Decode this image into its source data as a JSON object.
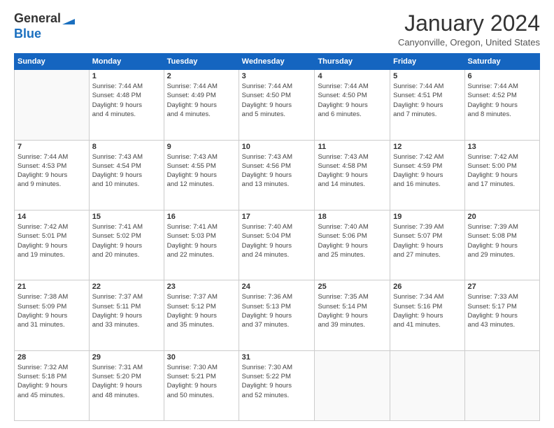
{
  "header": {
    "logo_line1": "General",
    "logo_line2": "Blue",
    "month": "January 2024",
    "location": "Canyonville, Oregon, United States"
  },
  "days_of_week": [
    "Sunday",
    "Monday",
    "Tuesday",
    "Wednesday",
    "Thursday",
    "Friday",
    "Saturday"
  ],
  "weeks": [
    [
      {
        "day": "",
        "info": ""
      },
      {
        "day": "1",
        "info": "Sunrise: 7:44 AM\nSunset: 4:48 PM\nDaylight: 9 hours\nand 4 minutes."
      },
      {
        "day": "2",
        "info": "Sunrise: 7:44 AM\nSunset: 4:49 PM\nDaylight: 9 hours\nand 4 minutes."
      },
      {
        "day": "3",
        "info": "Sunrise: 7:44 AM\nSunset: 4:50 PM\nDaylight: 9 hours\nand 5 minutes."
      },
      {
        "day": "4",
        "info": "Sunrise: 7:44 AM\nSunset: 4:50 PM\nDaylight: 9 hours\nand 6 minutes."
      },
      {
        "day": "5",
        "info": "Sunrise: 7:44 AM\nSunset: 4:51 PM\nDaylight: 9 hours\nand 7 minutes."
      },
      {
        "day": "6",
        "info": "Sunrise: 7:44 AM\nSunset: 4:52 PM\nDaylight: 9 hours\nand 8 minutes."
      }
    ],
    [
      {
        "day": "7",
        "info": "Sunrise: 7:44 AM\nSunset: 4:53 PM\nDaylight: 9 hours\nand 9 minutes."
      },
      {
        "day": "8",
        "info": "Sunrise: 7:43 AM\nSunset: 4:54 PM\nDaylight: 9 hours\nand 10 minutes."
      },
      {
        "day": "9",
        "info": "Sunrise: 7:43 AM\nSunset: 4:55 PM\nDaylight: 9 hours\nand 12 minutes."
      },
      {
        "day": "10",
        "info": "Sunrise: 7:43 AM\nSunset: 4:56 PM\nDaylight: 9 hours\nand 13 minutes."
      },
      {
        "day": "11",
        "info": "Sunrise: 7:43 AM\nSunset: 4:58 PM\nDaylight: 9 hours\nand 14 minutes."
      },
      {
        "day": "12",
        "info": "Sunrise: 7:42 AM\nSunset: 4:59 PM\nDaylight: 9 hours\nand 16 minutes."
      },
      {
        "day": "13",
        "info": "Sunrise: 7:42 AM\nSunset: 5:00 PM\nDaylight: 9 hours\nand 17 minutes."
      }
    ],
    [
      {
        "day": "14",
        "info": "Sunrise: 7:42 AM\nSunset: 5:01 PM\nDaylight: 9 hours\nand 19 minutes."
      },
      {
        "day": "15",
        "info": "Sunrise: 7:41 AM\nSunset: 5:02 PM\nDaylight: 9 hours\nand 20 minutes."
      },
      {
        "day": "16",
        "info": "Sunrise: 7:41 AM\nSunset: 5:03 PM\nDaylight: 9 hours\nand 22 minutes."
      },
      {
        "day": "17",
        "info": "Sunrise: 7:40 AM\nSunset: 5:04 PM\nDaylight: 9 hours\nand 24 minutes."
      },
      {
        "day": "18",
        "info": "Sunrise: 7:40 AM\nSunset: 5:06 PM\nDaylight: 9 hours\nand 25 minutes."
      },
      {
        "day": "19",
        "info": "Sunrise: 7:39 AM\nSunset: 5:07 PM\nDaylight: 9 hours\nand 27 minutes."
      },
      {
        "day": "20",
        "info": "Sunrise: 7:39 AM\nSunset: 5:08 PM\nDaylight: 9 hours\nand 29 minutes."
      }
    ],
    [
      {
        "day": "21",
        "info": "Sunrise: 7:38 AM\nSunset: 5:09 PM\nDaylight: 9 hours\nand 31 minutes."
      },
      {
        "day": "22",
        "info": "Sunrise: 7:37 AM\nSunset: 5:11 PM\nDaylight: 9 hours\nand 33 minutes."
      },
      {
        "day": "23",
        "info": "Sunrise: 7:37 AM\nSunset: 5:12 PM\nDaylight: 9 hours\nand 35 minutes."
      },
      {
        "day": "24",
        "info": "Sunrise: 7:36 AM\nSunset: 5:13 PM\nDaylight: 9 hours\nand 37 minutes."
      },
      {
        "day": "25",
        "info": "Sunrise: 7:35 AM\nSunset: 5:14 PM\nDaylight: 9 hours\nand 39 minutes."
      },
      {
        "day": "26",
        "info": "Sunrise: 7:34 AM\nSunset: 5:16 PM\nDaylight: 9 hours\nand 41 minutes."
      },
      {
        "day": "27",
        "info": "Sunrise: 7:33 AM\nSunset: 5:17 PM\nDaylight: 9 hours\nand 43 minutes."
      }
    ],
    [
      {
        "day": "28",
        "info": "Sunrise: 7:32 AM\nSunset: 5:18 PM\nDaylight: 9 hours\nand 45 minutes."
      },
      {
        "day": "29",
        "info": "Sunrise: 7:31 AM\nSunset: 5:20 PM\nDaylight: 9 hours\nand 48 minutes."
      },
      {
        "day": "30",
        "info": "Sunrise: 7:30 AM\nSunset: 5:21 PM\nDaylight: 9 hours\nand 50 minutes."
      },
      {
        "day": "31",
        "info": "Sunrise: 7:30 AM\nSunset: 5:22 PM\nDaylight: 9 hours\nand 52 minutes."
      },
      {
        "day": "",
        "info": ""
      },
      {
        "day": "",
        "info": ""
      },
      {
        "day": "",
        "info": ""
      }
    ]
  ]
}
